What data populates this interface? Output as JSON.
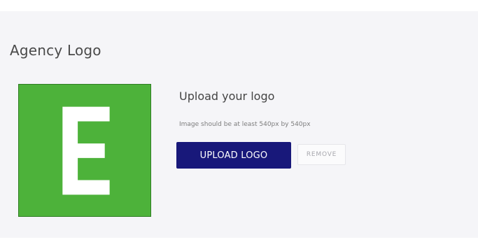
{
  "section": {
    "title": "Agency Logo"
  },
  "logo": {
    "letter": "E",
    "background_color": "#4db23a",
    "letter_color": "#ffffff"
  },
  "upload": {
    "title": "Upload your logo",
    "hint": "Image should be at least 540px by 540px",
    "upload_button_label": "UPLOAD LOGO",
    "remove_button_label": "REMOVE",
    "accent_color": "#18187a"
  }
}
